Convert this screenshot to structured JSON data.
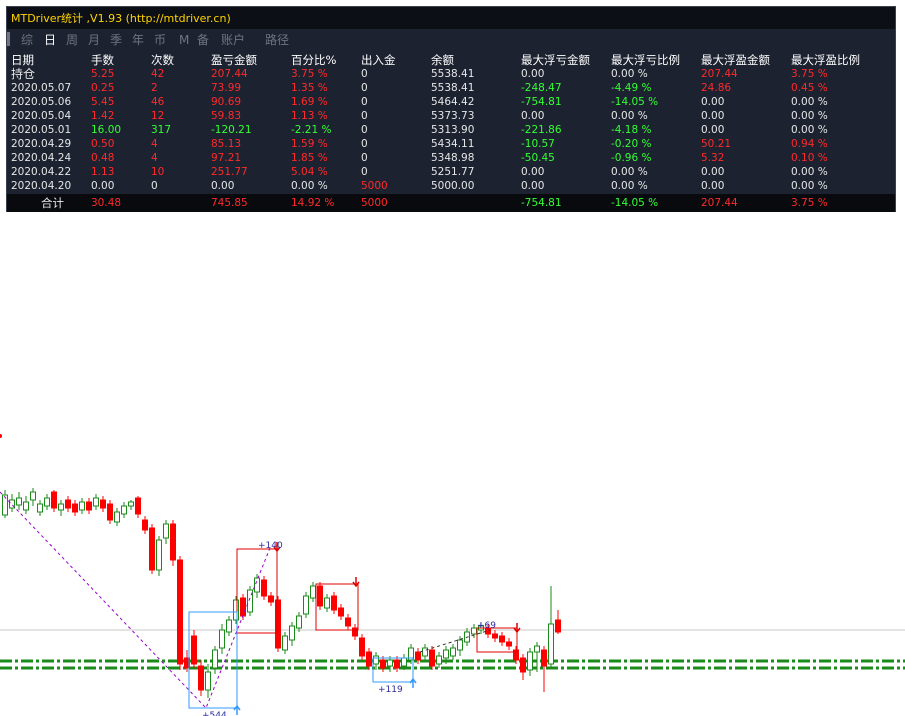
{
  "app": {
    "title": "MTDriver统计 ,V1.93 (http://mtdriver.cn)"
  },
  "tabs": [
    {
      "label": "综",
      "active": false
    },
    {
      "label": "日",
      "active": true
    },
    {
      "label": "周",
      "active": false
    },
    {
      "label": "月",
      "active": false
    },
    {
      "label": "季",
      "active": false
    },
    {
      "label": "年",
      "active": false
    },
    {
      "label": "币",
      "active": false
    },
    {
      "label": "M",
      "active": false
    },
    {
      "label": "备",
      "active": false
    },
    {
      "label": "账户",
      "active": false
    },
    {
      "label": "路径",
      "active": false
    }
  ],
  "table": {
    "headers": [
      "日期",
      "手数",
      "次数",
      "盈亏金额",
      "百分比%",
      "出入金",
      "余额",
      "最大浮亏金额",
      "最大浮亏比例",
      "最大浮盈金额",
      "最大浮盈比例"
    ],
    "rows": [
      {
        "date": "持仓",
        "lots": "5.25",
        "count": "42",
        "pnl": "207.44",
        "pct": "3.75 %",
        "deposit": "0",
        "balance": "5538.41",
        "maxdd": "0.00",
        "maxdd_pct": "0.00 %",
        "maxgain": "207.44",
        "maxgain_pct": "3.75 %",
        "colors": [
          "white",
          "red",
          "red",
          "red",
          "red",
          "white",
          "white",
          "white",
          "white",
          "red",
          "red"
        ]
      },
      {
        "date": "2020.05.07",
        "lots": "0.25",
        "count": "2",
        "pnl": "73.99",
        "pct": "1.35 %",
        "deposit": "0",
        "balance": "5538.41",
        "maxdd": "-248.47",
        "maxdd_pct": "-4.49 %",
        "maxgain": "24.86",
        "maxgain_pct": "0.45 %",
        "colors": [
          "white",
          "red",
          "red",
          "red",
          "red",
          "white",
          "white",
          "green",
          "green",
          "red",
          "red"
        ]
      },
      {
        "date": "2020.05.06",
        "lots": "5.45",
        "count": "46",
        "pnl": "90.69",
        "pct": "1.69 %",
        "deposit": "0",
        "balance": "5464.42",
        "maxdd": "-754.81",
        "maxdd_pct": "-14.05 %",
        "maxgain": "0.00",
        "maxgain_pct": "0.00 %",
        "colors": [
          "white",
          "red",
          "red",
          "red",
          "red",
          "white",
          "white",
          "green",
          "green",
          "white",
          "white"
        ]
      },
      {
        "date": "2020.05.04",
        "lots": "1.42",
        "count": "12",
        "pnl": "59.83",
        "pct": "1.13 %",
        "deposit": "0",
        "balance": "5373.73",
        "maxdd": "0.00",
        "maxdd_pct": "0.00 %",
        "maxgain": "0.00",
        "maxgain_pct": "0.00 %",
        "colors": [
          "white",
          "red",
          "red",
          "red",
          "red",
          "white",
          "white",
          "white",
          "white",
          "white",
          "white"
        ]
      },
      {
        "date": "2020.05.01",
        "lots": "16.00",
        "count": "317",
        "pnl": "-120.21",
        "pct": "-2.21 %",
        "deposit": "0",
        "balance": "5313.90",
        "maxdd": "-221.86",
        "maxdd_pct": "-4.18 %",
        "maxgain": "0.00",
        "maxgain_pct": "0.00 %",
        "colors": [
          "white",
          "green",
          "green",
          "green",
          "green",
          "white",
          "white",
          "green",
          "green",
          "white",
          "white"
        ]
      },
      {
        "date": "2020.04.29",
        "lots": "0.50",
        "count": "4",
        "pnl": "85.13",
        "pct": "1.59 %",
        "deposit": "0",
        "balance": "5434.11",
        "maxdd": "-10.57",
        "maxdd_pct": "-0.20 %",
        "maxgain": "50.21",
        "maxgain_pct": "0.94 %",
        "colors": [
          "white",
          "red",
          "red",
          "red",
          "red",
          "white",
          "white",
          "green",
          "green",
          "red",
          "red"
        ]
      },
      {
        "date": "2020.04.24",
        "lots": "0.48",
        "count": "4",
        "pnl": "97.21",
        "pct": "1.85 %",
        "deposit": "0",
        "balance": "5348.98",
        "maxdd": "-50.45",
        "maxdd_pct": "-0.96 %",
        "maxgain": "5.32",
        "maxgain_pct": "0.10 %",
        "colors": [
          "white",
          "red",
          "red",
          "red",
          "red",
          "white",
          "white",
          "green",
          "green",
          "red",
          "red"
        ]
      },
      {
        "date": "2020.04.22",
        "lots": "1.13",
        "count": "10",
        "pnl": "251.77",
        "pct": "5.04 %",
        "deposit": "0",
        "balance": "5251.77",
        "maxdd": "0.00",
        "maxdd_pct": "0.00 %",
        "maxgain": "0.00",
        "maxgain_pct": "0.00 %",
        "colors": [
          "white",
          "red",
          "red",
          "red",
          "red",
          "white",
          "white",
          "white",
          "white",
          "white",
          "white"
        ]
      },
      {
        "date": "2020.04.20",
        "lots": "0.00",
        "count": "0",
        "pnl": "0.00",
        "pct": "0.00 %",
        "deposit": "5000",
        "balance": "5000.00",
        "maxdd": "0.00",
        "maxdd_pct": "0.00 %",
        "maxgain": "0.00",
        "maxgain_pct": "0.00 %",
        "colors": [
          "white",
          "white",
          "white",
          "white",
          "white",
          "red",
          "white",
          "white",
          "white",
          "white",
          "white"
        ]
      }
    ],
    "total": {
      "label": "合计",
      "lots": "30.48",
      "count": "",
      "pnl": "745.85",
      "pct": "14.92 %",
      "deposit": "5000",
      "balance": "",
      "maxdd": "-754.81",
      "maxdd_pct": "-14.05 %",
      "maxgain": "207.44",
      "maxgain_pct": "3.75 %"
    }
  },
  "chart": {
    "labels": [
      "+140",
      "+69",
      "+119",
      "+544"
    ],
    "colors": {
      "bull": "#1a8a1a",
      "bear": "#ff0000",
      "box_red": "#e00000",
      "box_blue": "#3399ff",
      "dash_line": "#1a8a1a",
      "trend": "#9900cc"
    }
  }
}
